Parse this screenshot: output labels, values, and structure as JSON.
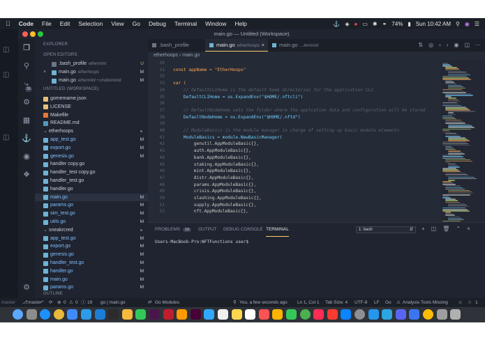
{
  "menubar": {
    "apple": "",
    "items": [
      "Code",
      "File",
      "Edit",
      "Selection",
      "View",
      "Go",
      "Debug",
      "Terminal",
      "Window",
      "Help"
    ],
    "battery": "74%",
    "clock": "Sun 10:42 AM"
  },
  "window": {
    "title": "main.go — Untitled (Workspace)"
  },
  "sidebar": {
    "explorer_title": "EXPLORER",
    "open_editors_title": "OPEN EDITORS",
    "open_editors": [
      {
        "name": ".bash_profile",
        "desc": "ethermint",
        "status": "U"
      },
      {
        "name": "main.go",
        "desc": "etherhoops",
        "status": "M"
      },
      {
        "name": "main.go",
        "desc": "ethermint • cmd/emintd",
        "status": "M"
      }
    ],
    "workspace_title": "UNTITLED (WORKSPACE)",
    "workspace_badge": "39",
    "files_top": [
      {
        "name": "gomemame.json",
        "status": ""
      },
      {
        "name": "LICENSE",
        "status": ""
      },
      {
        "name": "Makefile",
        "status": ""
      },
      {
        "name": "README.md",
        "status": ""
      }
    ],
    "folder1": "etherhoops",
    "folder1_files": [
      {
        "name": "app_test.go",
        "status": "M"
      },
      {
        "name": "export.go",
        "status": "M"
      },
      {
        "name": "genesis.go",
        "status": "M"
      },
      {
        "name": "handler copy.go",
        "status": ""
      },
      {
        "name": "handler_test copy.go",
        "status": ""
      },
      {
        "name": "handler_test.go",
        "status": ""
      },
      {
        "name": "handler.go",
        "status": ""
      },
      {
        "name": "main.go",
        "status": "M"
      },
      {
        "name": "params.go",
        "status": "M"
      },
      {
        "name": "sim_test.go",
        "status": "M"
      },
      {
        "name": "utils.go",
        "status": "M"
      }
    ],
    "folder2": "sneakrcred",
    "folder2_files": [
      {
        "name": "app_test.go",
        "status": "M"
      },
      {
        "name": "export.go",
        "status": "M"
      },
      {
        "name": "genesis.go",
        "status": "M"
      },
      {
        "name": "handler_test.go",
        "status": "M"
      },
      {
        "name": "handler.go",
        "status": "M"
      },
      {
        "name": "main.go",
        "status": "M"
      },
      {
        "name": "params.go",
        "status": "M"
      }
    ],
    "outline_title": "OUTLINE"
  },
  "tabs": [
    {
      "label": ".bash_profile",
      "desc": ""
    },
    {
      "label": "main.go",
      "desc": "etherhoops",
      "close": "×"
    },
    {
      "label": "main.go",
      "desc": "...lemintd"
    }
  ],
  "breadcrumb": [
    "etherhoops",
    "main.go"
  ],
  "code": [
    {
      "n": "30",
      "t": ""
    },
    {
      "n": "31",
      "t": "const appName = \"EtherHoops\""
    },
    {
      "n": "32",
      "t": ""
    },
    {
      "n": "33",
      "t": "var ("
    },
    {
      "n": "34",
      "t": "    // DefaultCLIHome is the default home directories for the application CLI"
    },
    {
      "n": "35",
      "t": "    DefaultCLIHome = os.ExpandEnv(\"$HOME/.nftcli\")"
    },
    {
      "n": "36",
      "t": ""
    },
    {
      "n": "37",
      "t": "    // DefaultNodeHome sets the folder where the applcation data and configuration will be stored"
    },
    {
      "n": "38",
      "t": "    DefaultNodeHome = os.ExpandEnv(\"$HOME/.nftd\")"
    },
    {
      "n": "39",
      "t": ""
    },
    {
      "n": "40",
      "t": "    // ModuleBasics is the module manager in charge of setting up basic module elements"
    },
    {
      "n": "41",
      "t": "    ModuleBasics = module.NewBasicManager("
    },
    {
      "n": "42",
      "t": "        genutil.AppModuleBasic{},"
    },
    {
      "n": "43",
      "t": "        auth.AppModuleBasic{},"
    },
    {
      "n": "44",
      "t": "        bank.AppModuleBasic{},"
    },
    {
      "n": "45",
      "t": "        staking.AppModuleBasic{},"
    },
    {
      "n": "46",
      "t": "        mint.AppModuleBasic{},"
    },
    {
      "n": "47",
      "t": "        distr.AppModuleBasic{},"
    },
    {
      "n": "48",
      "t": "        params.AppModuleBasic{},"
    },
    {
      "n": "49",
      "t": "        crisis.AppModuleBasic{},"
    },
    {
      "n": "50",
      "t": "        slashing.AppModuleBasic{},"
    },
    {
      "n": "51",
      "t": "        supply.AppModuleBasic{},"
    },
    {
      "n": "52",
      "t": "        nft.AppModuleBasic{},"
    }
  ],
  "panel": {
    "tabs": [
      "PROBLEMS",
      "OUTPUT",
      "DEBUG CONSOLE",
      "TERMINAL"
    ],
    "problems_count": "19",
    "terminal_select": "1: bash",
    "terminal_line": "Users-MacBook-Pro:NFTFunctions user$"
  },
  "status": {
    "left_strip": "master",
    "branch": "master*",
    "errors": "0",
    "warnings": "0",
    "info": "19",
    "gopath": "go | main.go",
    "gomodules": "Go Modules",
    "blame": "You, a few seconds ago",
    "position": "Ln 1, Col 1",
    "tabsize": "Tab Size: 4",
    "encoding": "UTF-8",
    "eol": "LF",
    "language": "Go",
    "analysis": "Analysis Tools Missing",
    "bell_count": "1"
  },
  "colors": {
    "accent": "#ffcc66",
    "modified": "#80bfff",
    "untracked": "#a6cc70"
  }
}
